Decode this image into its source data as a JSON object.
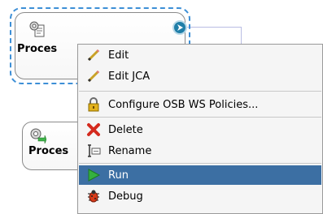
{
  "components": [
    {
      "title": "Proces",
      "selected": true
    },
    {
      "title": "Proces",
      "selected": false
    }
  ],
  "context_menu": {
    "items": [
      {
        "label": "Edit",
        "icon": "pencil-icon"
      },
      {
        "label": "Edit JCA",
        "icon": "pencil-icon"
      },
      {
        "label": "Configure OSB WS Policies...",
        "icon": "lock-icon"
      },
      {
        "label": "Delete",
        "icon": "red-x-icon"
      },
      {
        "label": "Rename",
        "icon": "rename-icon"
      },
      {
        "label": "Run",
        "icon": "green-play-icon",
        "highlighted": true
      },
      {
        "label": "Debug",
        "icon": "bug-icon"
      }
    ]
  },
  "colors": {
    "selection_border": "#3d8fd6",
    "menu_highlight": "#3c6fa3",
    "connector": "#1f7ea8"
  }
}
